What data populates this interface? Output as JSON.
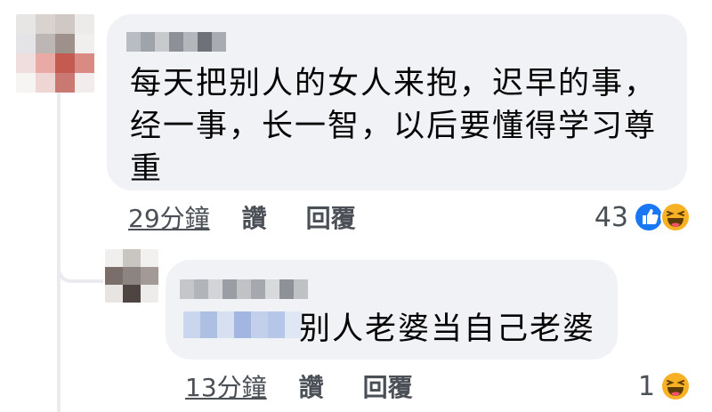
{
  "comment": {
    "text": "每天把别人的女人来抱，迟早的事，经一事，长一智，以后要懂得学习尊重",
    "timestamp": "29分鐘",
    "like_label": "讚",
    "reply_label": "回覆",
    "reaction_count": "43",
    "reactions": [
      "like-icon",
      "haha-icon"
    ],
    "author_blurred": true
  },
  "reply": {
    "text": "别人老婆当自己老婆",
    "timestamp": "13分鐘",
    "like_label": "讚",
    "reply_label": "回覆",
    "reaction_count": "1",
    "reactions": [
      "haha-icon"
    ],
    "author_blurred": true,
    "mention_blurred": true
  },
  "colors": {
    "bubble_bg": "#f0f2f5",
    "text": "#050505",
    "meta_text": "#4b4f56",
    "like_blue": "#1877f2",
    "haha_yellow": "#f7b125"
  }
}
